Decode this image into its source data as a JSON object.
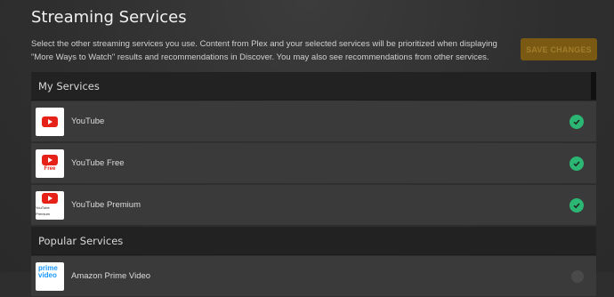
{
  "page": {
    "title": "Streaming Services",
    "description": "Select the other streaming services you use. Content from Plex and your selected services will be prioritized when displaying \"More Ways to Watch\" results and recommendations in Discover. You may also see recommendations from other services.",
    "save_label": "SAVE CHANGES"
  },
  "my_services": {
    "header": "My Services",
    "items": [
      {
        "name": "YouTube",
        "logo_sub": ""
      },
      {
        "name": "YouTube Free",
        "logo_sub": "Free"
      },
      {
        "name": "YouTube Premium",
        "logo_sub": "YouTube Premium"
      }
    ]
  },
  "popular_services": {
    "header": "Popular Services",
    "items": [
      {
        "name": "Amazon Prime Video",
        "logo_top": "prime",
        "logo_bottom": "video"
      }
    ]
  },
  "colors": {
    "accent": "#e5a00d",
    "check": "#2bb673"
  }
}
